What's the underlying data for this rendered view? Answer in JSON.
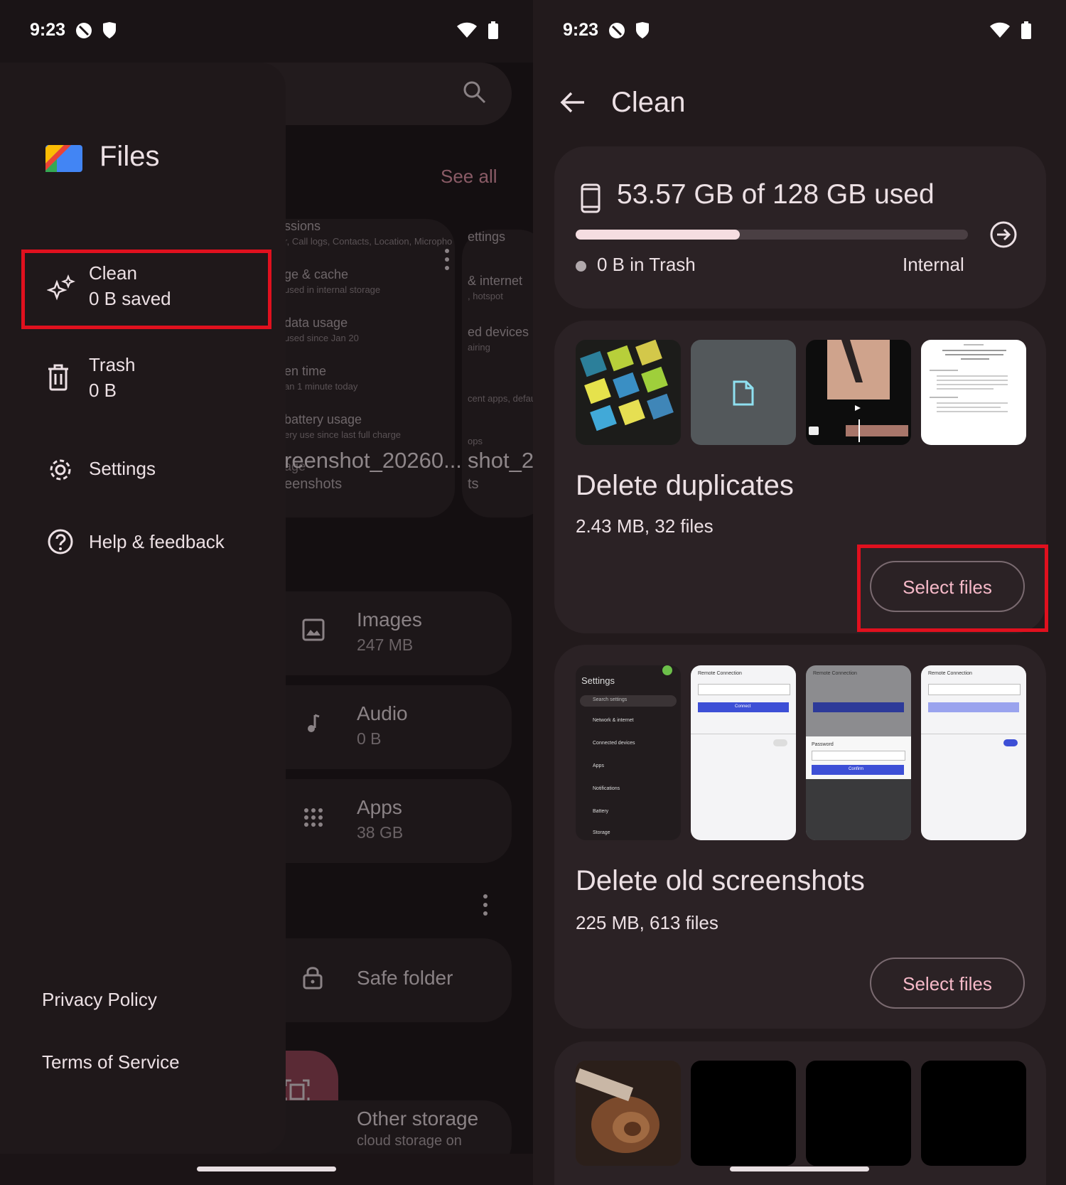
{
  "left": {
    "status": {
      "time": "9:23"
    },
    "background": {
      "see_all": "See all",
      "card_lines": [
        {
          "title": "ssions",
          "sub": "r, Call logs, Contacts, Location, Micropho"
        },
        {
          "title": "ge & cache",
          "sub": "used in internal storage"
        },
        {
          "title": "data usage",
          "sub": "used since Jan 20"
        },
        {
          "title": "en time",
          "sub": "an 1 minute today"
        },
        {
          "title": "battery usage",
          "sub": "ery use since last full charge"
        }
      ],
      "card2_lines": [
        {
          "title": "ettings",
          "sub": ""
        },
        {
          "title": "& internet",
          "sub": ", hotspot"
        },
        {
          "title": "ed devices",
          "sub": "airing"
        },
        {
          "title": "",
          "sub": "cent apps, defaul"
        }
      ],
      "screenshot_name_1": "reenshot_20260...",
      "screenshot_folder_1": "eenshots",
      "screenshot_name_2": "shot_20",
      "screenshot_folder_2": "ts",
      "overlap_1": "age",
      "overlap_2": "ops",
      "rows": [
        {
          "title": "Images",
          "sub": "247 MB",
          "icon": "image-icon"
        },
        {
          "title": "Audio",
          "sub": "0 B",
          "icon": "music-note-icon"
        },
        {
          "title": "Apps",
          "sub": "38 GB",
          "icon": "apps-grid-icon"
        }
      ],
      "safe_folder": "Safe folder",
      "other_storage": "Other storage",
      "other_storage_sub": "cloud storage on"
    },
    "drawer": {
      "app_title": "Files",
      "items": [
        {
          "label": "Clean",
          "sub": "0 B saved",
          "icon": "sparkle-icon"
        },
        {
          "label": "Trash",
          "sub": "0 B",
          "icon": "trash-icon"
        },
        {
          "label": "Settings",
          "sub": "",
          "icon": "gear-icon"
        },
        {
          "label": "Help & feedback",
          "sub": "",
          "icon": "help-icon"
        }
      ],
      "privacy": "Privacy Policy",
      "terms": "Terms of Service"
    }
  },
  "right": {
    "status": {
      "time": "9:23"
    },
    "title": "Clean",
    "storage": {
      "used_text": "53.57 GB of 128 GB used",
      "used_fraction": 0.4185,
      "trash_text": "0 B in Trash",
      "location": "Internal"
    },
    "cards": [
      {
        "title": "Delete duplicates",
        "sub": "2.43 MB, 32 files",
        "button": "Select files"
      },
      {
        "title": "Delete old screenshots",
        "sub": "225 MB, 613 files",
        "button": "Select files"
      }
    ],
    "thumb_text": {
      "settings": "Settings",
      "search_settings": "Search settings",
      "network": "Network & internet",
      "connected": "Connected devices",
      "apps": "Apps",
      "notifications": "Notifications",
      "battery": "Battery",
      "storage": "Storage",
      "remote": "Remote Connection",
      "connect": "Connect",
      "confirm": "Confirm",
      "password": "Password"
    }
  },
  "colors": {
    "accent": "#f6b9c8",
    "highlight_red": "#e0101e",
    "background": "#221a1c",
    "card": "#2b2225"
  }
}
